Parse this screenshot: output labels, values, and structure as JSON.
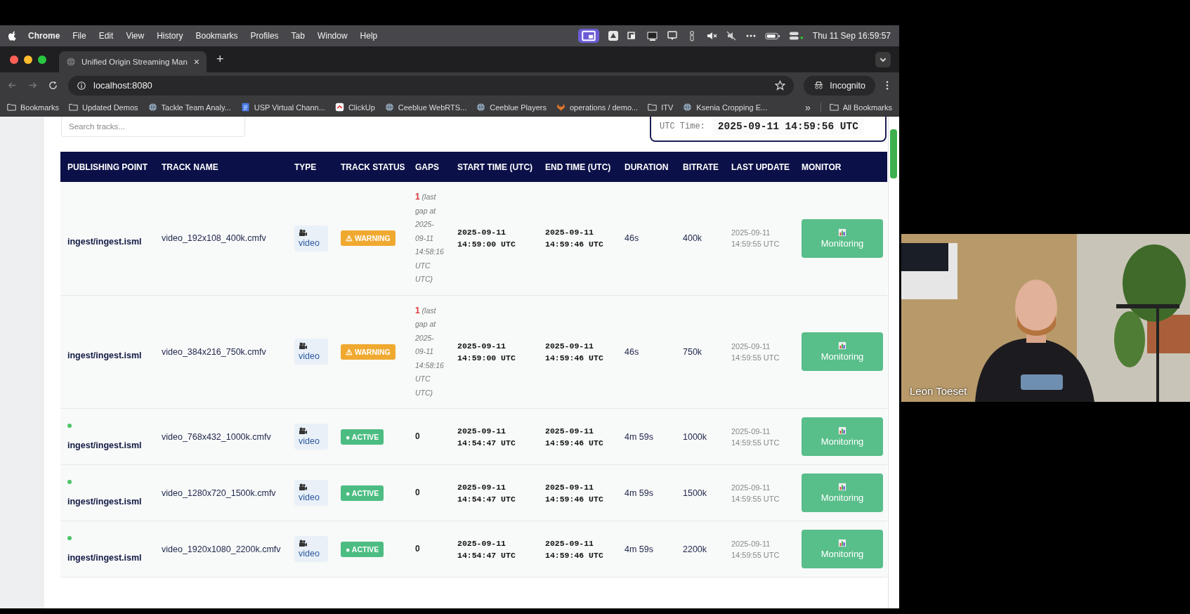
{
  "menu_bar": {
    "app": "Chrome",
    "items": [
      "File",
      "Edit",
      "View",
      "History",
      "Bookmarks",
      "Profiles",
      "Tab",
      "Window",
      "Help"
    ],
    "clock": "Thu 11 Sep  16:59:57"
  },
  "browser_tab": {
    "title": "Unified Origin Streaming Man",
    "close": "×",
    "new_tab": "+"
  },
  "address_bar": {
    "url": "localhost:8080",
    "profile": "Incognito"
  },
  "bookmarks": [
    {
      "label": "Bookmarks",
      "kind": "folder"
    },
    {
      "label": "Updated Demos",
      "kind": "folder"
    },
    {
      "label": "Tackle Team Analy...",
      "kind": "globe"
    },
    {
      "label": "USP Virtual Chann...",
      "kind": "doc"
    },
    {
      "label": "ClickUp",
      "kind": "app"
    },
    {
      "label": "Ceeblue WebRTS...",
      "kind": "globe"
    },
    {
      "label": "Ceeblue Players",
      "kind": "globe"
    },
    {
      "label": "operations / demo...",
      "kind": "fox"
    },
    {
      "label": "ITV",
      "kind": "folder"
    },
    {
      "label": "Ksenia Cropping E...",
      "kind": "globe"
    }
  ],
  "bookmarks_more": "»",
  "all_bookmarks": "All Bookmarks",
  "search": {
    "placeholder": "Search tracks..."
  },
  "utc_clock": {
    "label": "UTC Time:",
    "value": "2025-09-11 14:59:56 UTC"
  },
  "table": {
    "columns": [
      "PUBLISHING POINT",
      "TRACK NAME",
      "TYPE",
      "TRACK STATUS",
      "GAPS",
      "START TIME (UTC)",
      "END TIME (UTC)",
      "DURATION",
      "BITRATE",
      "LAST UPDATE",
      "MONITOR"
    ],
    "rows": [
      {
        "publishing_point": "ingest/ingest.isml",
        "online": false,
        "track": "video_192x108_400k.cmfv",
        "type": "video",
        "status": {
          "kind": "warning",
          "label": "⚠ WARNING"
        },
        "gaps": "1",
        "gap_note": "(last gap at 2025-09-11 14:58:16 UTC UTC)",
        "start": "2025-09-11 14:59:00 UTC",
        "end": "2025-09-11 14:59:46 UTC",
        "duration": "46s",
        "bitrate": "400k",
        "last_update": "2025-09-11 14:59:55 UTC",
        "action": "Monitoring"
      },
      {
        "publishing_point": "ingest/ingest.isml",
        "online": false,
        "track": "video_384x216_750k.cmfv",
        "type": "video",
        "status": {
          "kind": "warning",
          "label": "⚠ WARNING"
        },
        "gaps": "1",
        "gap_note": "(last gap at 2025-09-11 14:58:16 UTC UTC)",
        "start": "2025-09-11 14:59:00 UTC",
        "end": "2025-09-11 14:59:46 UTC",
        "duration": "46s",
        "bitrate": "750k",
        "last_update": "2025-09-11 14:59:55 UTC",
        "action": "Monitoring"
      },
      {
        "publishing_point": "ingest/ingest.isml",
        "online": true,
        "track": "video_768x432_1000k.cmfv",
        "type": "video",
        "status": {
          "kind": "active",
          "label": "● ACTIVE"
        },
        "gaps": "0",
        "start": "2025-09-11 14:54:47 UTC",
        "end": "2025-09-11 14:59:46 UTC",
        "duration": "4m 59s",
        "bitrate": "1000k",
        "last_update": "2025-09-11 14:59:55 UTC",
        "action": "Monitoring"
      },
      {
        "publishing_point": "ingest/ingest.isml",
        "online": true,
        "track": "video_1280x720_1500k.cmfv",
        "type": "video",
        "status": {
          "kind": "active",
          "label": "● ACTIVE"
        },
        "gaps": "0",
        "start": "2025-09-11 14:54:47 UTC",
        "end": "2025-09-11 14:59:46 UTC",
        "duration": "4m 59s",
        "bitrate": "1500k",
        "last_update": "2025-09-11 14:59:55 UTC",
        "action": "Monitoring"
      },
      {
        "publishing_point": "ingest/ingest.isml",
        "online": true,
        "track": "video_1920x1080_2200k.cmfv",
        "type": "video",
        "status": {
          "kind": "active",
          "label": "● ACTIVE"
        },
        "gaps": "0",
        "start": "2025-09-11 14:54:47 UTC",
        "end": "2025-09-11 14:59:46 UTC",
        "duration": "4m 59s",
        "bitrate": "2200k",
        "last_update": "2025-09-11 14:59:55 UTC",
        "action": "Monitoring"
      }
    ]
  },
  "webcam": {
    "kind": "picture",
    "name": "Leon Toeset"
  }
}
